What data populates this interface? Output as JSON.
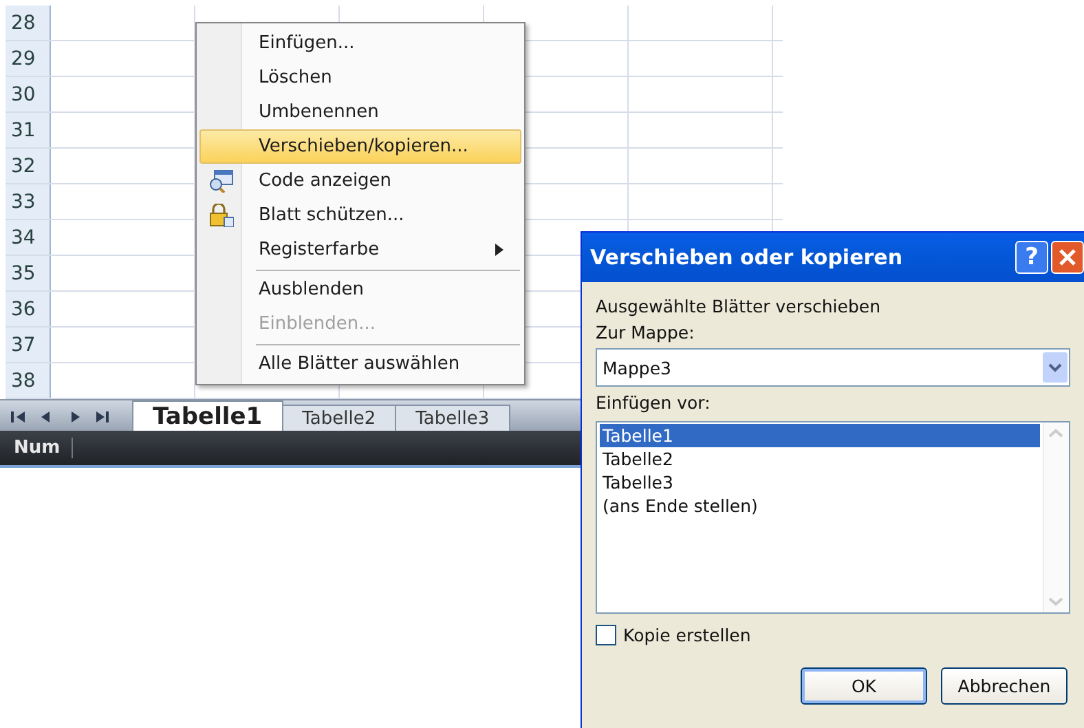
{
  "sheet": {
    "row_numbers": [
      "28",
      "29",
      "30",
      "31",
      "32",
      "33",
      "34",
      "35",
      "36",
      "37",
      "38"
    ]
  },
  "sheet_tabs": [
    {
      "label": "Tabelle1",
      "selected": true
    },
    {
      "label": "Tabelle2",
      "selected": false
    },
    {
      "label": "Tabelle3",
      "selected": false
    }
  ],
  "status_bar": {
    "mode": "Num"
  },
  "context_menu": {
    "items": [
      {
        "label": "Einfügen...",
        "kind": "plain",
        "selected": false,
        "disabled": false,
        "submenu": false,
        "separator_before": false
      },
      {
        "label": "Löschen",
        "kind": "plain",
        "selected": false,
        "disabled": false,
        "submenu": false,
        "separator_before": false
      },
      {
        "label": "Umbenennen",
        "kind": "plain",
        "selected": false,
        "disabled": false,
        "submenu": false,
        "separator_before": false
      },
      {
        "label": "Verschieben/kopieren...",
        "kind": "plain",
        "selected": true,
        "disabled": false,
        "submenu": false,
        "separator_before": false
      },
      {
        "label": "Code anzeigen",
        "kind": "code",
        "selected": false,
        "disabled": false,
        "submenu": false,
        "separator_before": false
      },
      {
        "label": "Blatt schützen...",
        "kind": "lock",
        "selected": false,
        "disabled": false,
        "submenu": false,
        "separator_before": false
      },
      {
        "label": "Registerfarbe",
        "kind": "plain",
        "selected": false,
        "disabled": false,
        "submenu": true,
        "separator_before": false
      },
      {
        "label": "Ausblenden",
        "kind": "plain",
        "selected": false,
        "disabled": false,
        "submenu": false,
        "separator_before": true
      },
      {
        "label": "Einblenden...",
        "kind": "plain",
        "selected": false,
        "disabled": true,
        "submenu": false,
        "separator_before": false
      },
      {
        "label": "Alle Blätter auswählen",
        "kind": "plain",
        "selected": false,
        "disabled": false,
        "submenu": false,
        "separator_before": true
      }
    ]
  },
  "dialog": {
    "title": "Verschieben oder kopieren",
    "help": "?",
    "intro": "Ausgewählte Blätter verschieben",
    "workbook_label": "Zur Mappe:",
    "workbook_value": "Mappe3",
    "before_label": "Einfügen vor:",
    "sheets": [
      {
        "label": "Tabelle1",
        "selected": true
      },
      {
        "label": "Tabelle2",
        "selected": false
      },
      {
        "label": "Tabelle3",
        "selected": false
      },
      {
        "label": "(ans Ende stellen)",
        "selected": false
      }
    ],
    "copy": {
      "label": "Kopie erstellen",
      "checked": false
    },
    "buttons": [
      {
        "label": "OK",
        "default": true
      },
      {
        "label": "Abbrechen",
        "default": false
      }
    ]
  }
}
